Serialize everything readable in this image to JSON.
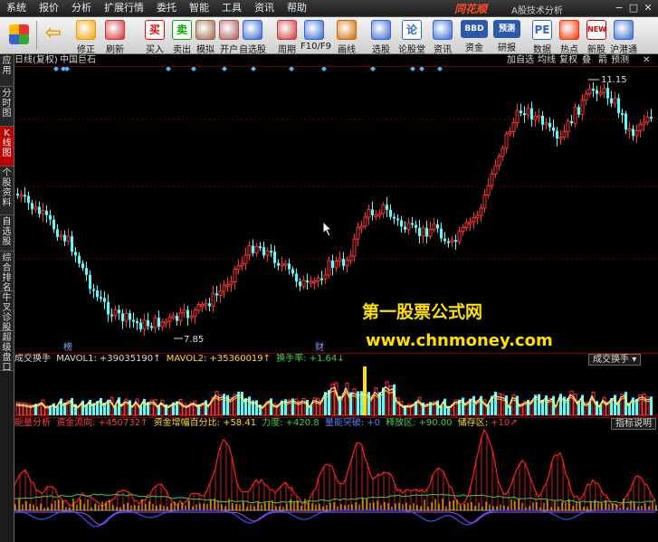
{
  "menu": [
    "系统",
    "报价",
    "分析",
    "扩展行情",
    "委托",
    "智能",
    "工具",
    "资讯",
    "帮助"
  ],
  "brand": "同花顺",
  "app_title": "A股技术分析",
  "toolbar": [
    {
      "label": "修正",
      "icon": "up-down-arrow-icon"
    },
    {
      "label": "刷新",
      "icon": "clock-icon"
    },
    {
      "label": "买入",
      "glyph": "买",
      "icon": "buy-icon"
    },
    {
      "label": "卖出",
      "glyph": "卖",
      "icon": "sell-icon"
    },
    {
      "label": "模拟",
      "icon": "gavel-icon"
    },
    {
      "label": "开户",
      "icon": "person-icon"
    },
    {
      "label": "自选股",
      "icon": "star-icon"
    },
    {
      "label": "周期",
      "icon": "clock-icon"
    },
    {
      "label": "F10/F9",
      "icon": "document-icon"
    },
    {
      "label": "画线",
      "icon": "pencil-icon"
    },
    {
      "label": "选股",
      "icon": "chart-icon"
    },
    {
      "label": "论股堂",
      "glyph": "论",
      "icon": "forum-icon"
    },
    {
      "label": "资讯",
      "icon": "news-icon"
    },
    {
      "label": "资金",
      "glyph2": "BBD",
      "icon": "fund-icon"
    },
    {
      "label": "研报",
      "glyph2": "预测",
      "icon": "report-icon"
    },
    {
      "label": "数据",
      "glyph": "PE",
      "icon": "pe-icon"
    },
    {
      "label": "热点",
      "icon": "fire-icon"
    },
    {
      "label": "新股",
      "glyph": "NEW",
      "icon": "new-icon"
    },
    {
      "label": "沪港通",
      "icon": "hk-connect-icon"
    }
  ],
  "sidebar": [
    "应用",
    "分时图",
    "K线图",
    "个股资料",
    "自选股",
    "综合排名",
    "牛叉诊股",
    "超级盘口"
  ],
  "chart_header": {
    "period": "日线(复权)",
    "stock": "中国巨石",
    "buttons": [
      "加自选",
      "均线",
      "复权",
      "叠",
      "箭",
      "预测"
    ]
  },
  "volume_header": {
    "name": "成交换手",
    "mavol1_label": "MAVOL1:",
    "mavol1": "+39035190↑",
    "mavol2_label": "MAVOL2:",
    "mavol2": "+35360019↑",
    "turnover_label": "换手率:",
    "turnover": "+1.64↓",
    "selector": "成交换手"
  },
  "indicator_header": {
    "name": "能量分析",
    "fund_flow_label": "资金流向:",
    "fund_flow": "+450732↑",
    "fund_pct_label": "资金增幅百分比:",
    "fund_pct": "+58.41",
    "force_label": "力度:",
    "force": "+420.8",
    "break_label": "量能突破:",
    "break": "+0",
    "release_label": "释放区:",
    "release": "+90.00",
    "store_label": "储存区:",
    "store": "+10↗",
    "tag": "指标说明"
  },
  "annotations": {
    "high": "11.15",
    "low": "7.85",
    "event1": "榜",
    "event2": "财"
  },
  "watermark": {
    "line1": "第一股票公式网",
    "line2": "www.chnmoney.com"
  },
  "colors": {
    "up": "#ff3232",
    "down": "#54ffff",
    "accent": "#ffe000",
    "menu_bg": "#2a2a2a"
  }
}
